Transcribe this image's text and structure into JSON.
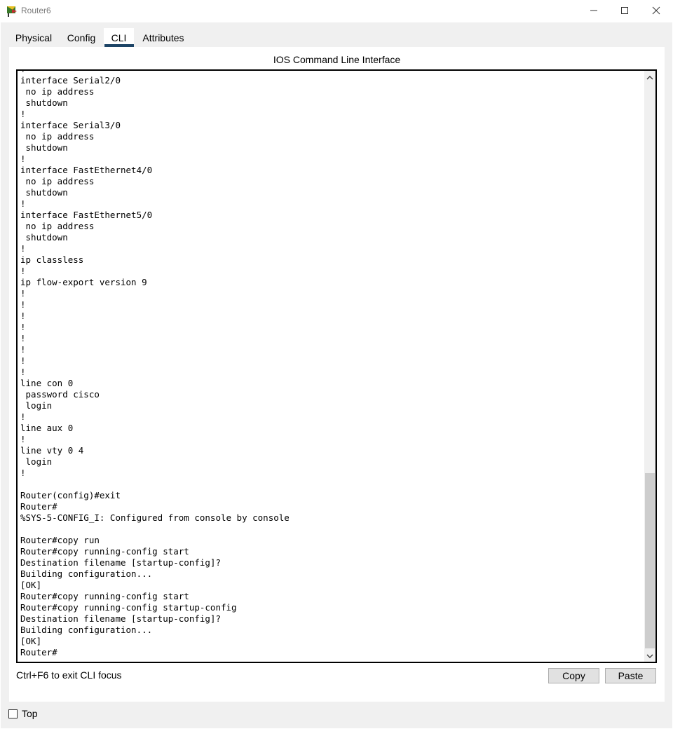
{
  "window": {
    "title": "Router6"
  },
  "tabs": [
    {
      "label": "Physical",
      "selected": false
    },
    {
      "label": "Config",
      "selected": false
    },
    {
      "label": "CLI",
      "selected": true
    },
    {
      "label": "Attributes",
      "selected": false
    }
  ],
  "panel": {
    "title": "IOS Command Line Interface"
  },
  "terminal": {
    "lines": [
      "!",
      "interface Serial2/0",
      " no ip address",
      " shutdown",
      "!",
      "interface Serial3/0",
      " no ip address",
      " shutdown",
      "!",
      "interface FastEthernet4/0",
      " no ip address",
      " shutdown",
      "!",
      "interface FastEthernet5/0",
      " no ip address",
      " shutdown",
      "!",
      "ip classless",
      "!",
      "ip flow-export version 9",
      "!",
      "!",
      "!",
      "!",
      "!",
      "!",
      "!",
      "!",
      "line con 0",
      " password cisco",
      " login",
      "!",
      "line aux 0",
      "!",
      "line vty 0 4",
      " login",
      "!",
      "",
      "Router(config)#exit",
      "Router#",
      "%SYS-5-CONFIG_I: Configured from console by console",
      "",
      "Router#copy run",
      "Router#copy running-config start",
      "Destination filename [startup-config]?",
      "Building configuration...",
      "[OK]",
      "Router#copy running-config start",
      "Router#copy running-config startup-config",
      "Destination filename [startup-config]?",
      "Building configuration...",
      "[OK]",
      "Router#"
    ]
  },
  "footer": {
    "hint": "Ctrl+F6 to exit CLI focus",
    "copy_label": "Copy",
    "paste_label": "Paste"
  },
  "top_checkbox": {
    "label": "Top",
    "checked": false
  },
  "colors": {
    "tab_underline": "#1d4466",
    "window_bg": "#f0f0f0"
  }
}
